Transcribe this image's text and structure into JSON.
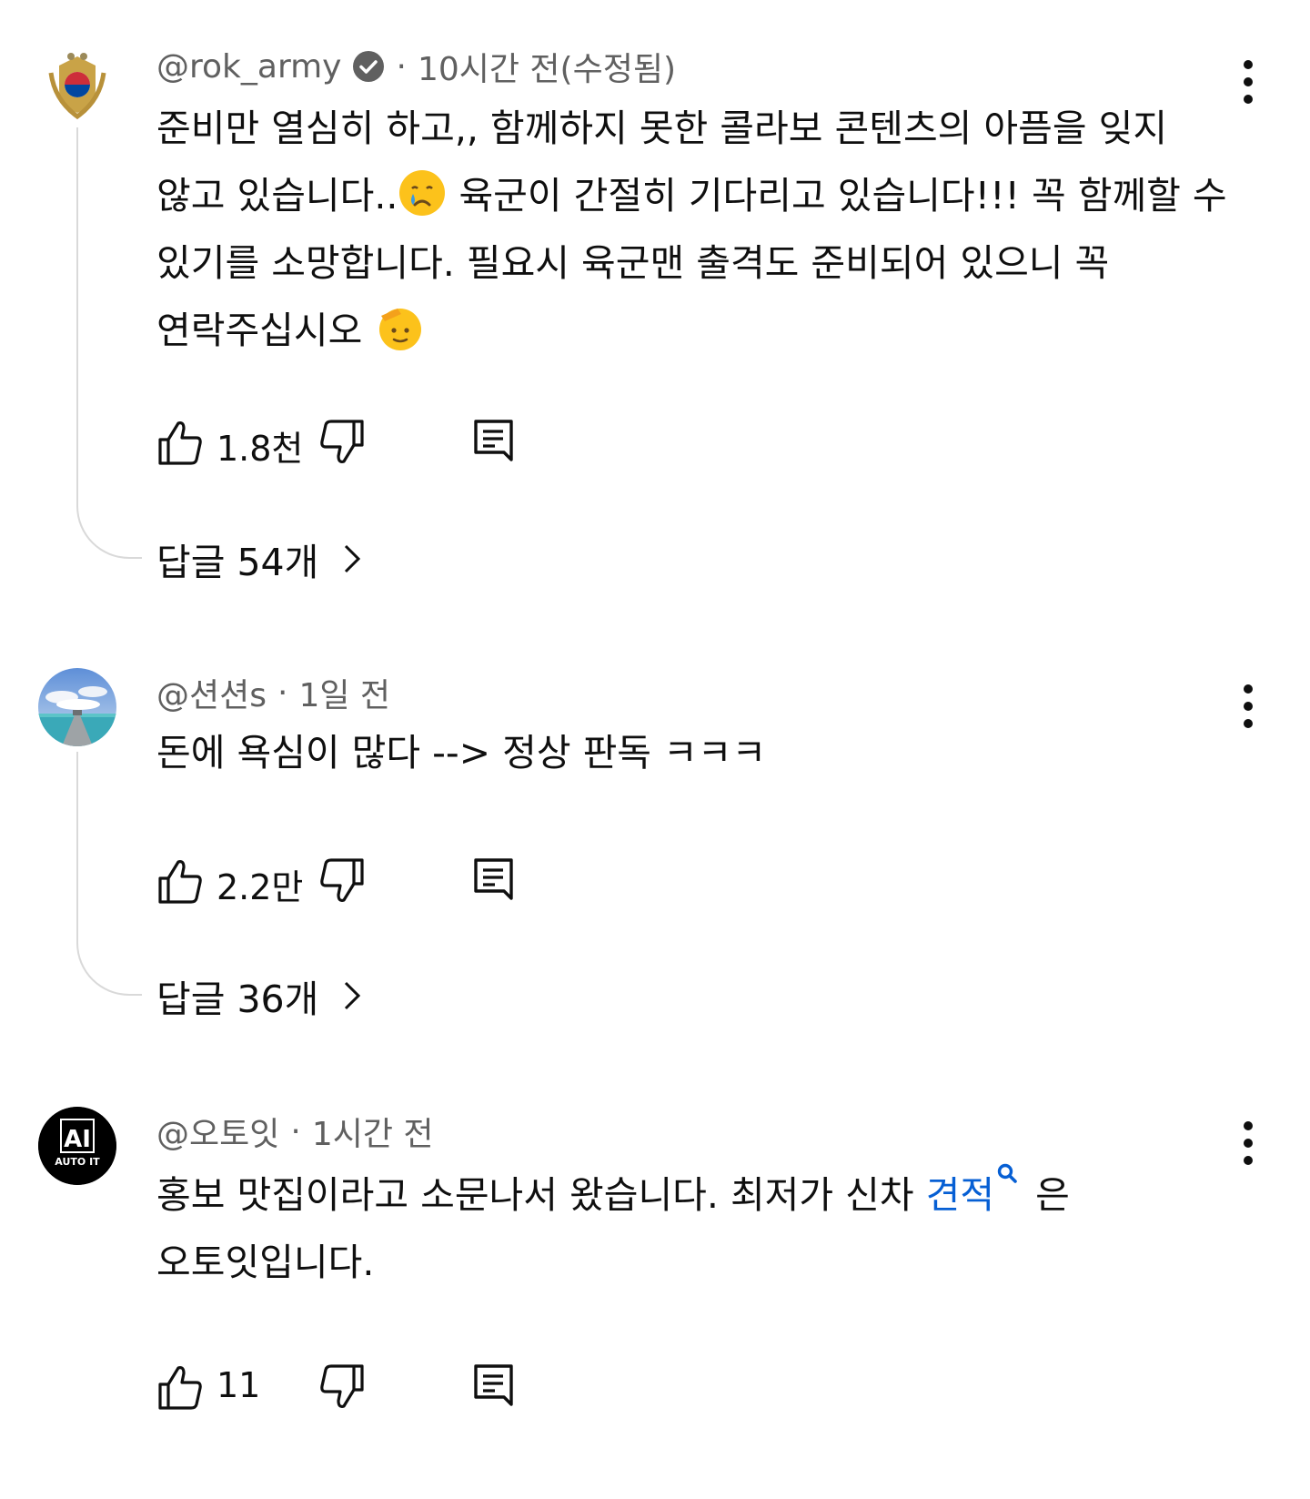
{
  "comments": [
    {
      "author": "@rok_army",
      "verified": true,
      "time": "10시간 전(수정됨)",
      "lines": [
        "준비만 열심히 하고,, 함께하지 못한 콜라보 콘텐츠의 아픔을 잊지",
        "않고 있습니다..",
        " 육군이 간절히 기다리고 있습니다!!! 꼭 함께할 수",
        "있기를 소망합니다. 필요시 육군맨 출격도 준비되어 있으니 꼭",
        "연락주십시오"
      ],
      "emojis": [
        "crying-face",
        "saluting-face"
      ],
      "likes": "1.8천",
      "replies": "답글 54개",
      "avatar": "rok-army-emblem"
    },
    {
      "author": "@션션s",
      "verified": false,
      "time": "1일 전",
      "lines": [
        "돈에 욕심이 많다 -->  정상 판독 ㅋㅋㅋ"
      ],
      "likes": "2.2만",
      "replies": "답글 36개",
      "avatar": "beach-pier-photo"
    },
    {
      "author": "@오토잇",
      "verified": false,
      "time": "1시간 전",
      "lines": [
        "홍보 맛집이라고 소문나서 왔습니다. 최저가 신차 ",
        " 은",
        "오토잇입니다."
      ],
      "link_text": "견적",
      "likes": "11",
      "avatar": "autoit-logo",
      "avatar_text": {
        "mark": "AI",
        "caption": "AUTO IT"
      }
    }
  ],
  "separator": "·",
  "colors": {
    "link": "#065fd4",
    "meta": "#606060",
    "text": "#0f0f0f",
    "thread": "#d9d9d9"
  },
  "icons": [
    "like-icon",
    "dislike-icon",
    "reply-icon",
    "more-vert-icon",
    "verified-check-icon",
    "chevron-right-icon",
    "search-icon"
  ]
}
